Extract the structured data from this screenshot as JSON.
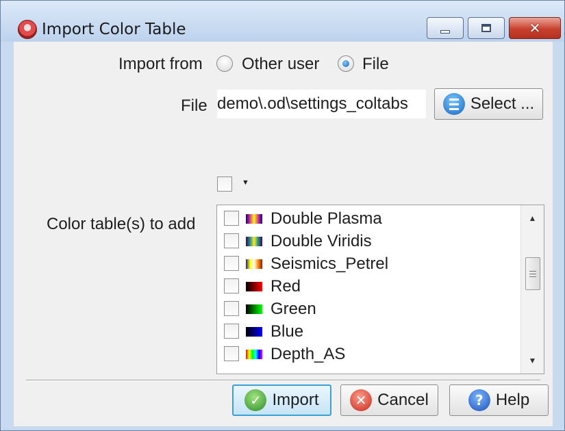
{
  "window": {
    "title": "Import Color Table",
    "close_glyph": "✕"
  },
  "import_from": {
    "label": "Import from",
    "options": [
      {
        "label": "Other user",
        "selected": false
      },
      {
        "label": "File",
        "selected": true
      }
    ]
  },
  "file": {
    "label": "File",
    "value": "demo\\.od\\settings_coltabs",
    "select_button": "Select ..."
  },
  "color_tables": {
    "label": "Color table(s) to add",
    "items": [
      {
        "name": "Double Plasma",
        "checked": false,
        "swatch": "double-plasma"
      },
      {
        "name": "Double Viridis",
        "checked": false,
        "swatch": "double-viridis"
      },
      {
        "name": "Seismics_Petrel",
        "checked": false,
        "swatch": "seismics-petrel"
      },
      {
        "name": "Red",
        "checked": false,
        "swatch": "red"
      },
      {
        "name": "Green",
        "checked": false,
        "swatch": "green"
      },
      {
        "name": "Blue",
        "checked": false,
        "swatch": "blue"
      },
      {
        "name": "Depth_AS",
        "checked": false,
        "swatch": "depth-as"
      }
    ]
  },
  "buttons": {
    "import": "Import",
    "cancel": "Cancel",
    "help": "Help"
  },
  "icons": {
    "check_glyph": "✓",
    "cancel_glyph": "✕",
    "help_glyph": "?",
    "dropdown_glyph": "▼",
    "scroll_up_glyph": "▲",
    "scroll_down_glyph": "▼"
  },
  "swatch_colors": {
    "double-plasma": "linear-gradient(90deg,#0d0887,#9c179e,#ed7953,#f0f921,#ed7953,#9c179e,#0d0887)",
    "double-viridis": "linear-gradient(90deg,#440154,#21918c,#fde725,#21918c,#440154)",
    "seismics-petrel": "linear-gradient(90deg,#1a1a8c,#ffff00,#ffffff,#ff8800,#8c1a1a)",
    "red": "linear-gradient(90deg,#000000,#ff0000)",
    "green": "linear-gradient(90deg,#000000,#00ff00)",
    "blue": "linear-gradient(90deg,#000000,#0000ff)",
    "depth-as": "linear-gradient(90deg,#ff0000,#ffff00,#00ff00,#00ffff,#0000ff,#ff00ff)"
  }
}
